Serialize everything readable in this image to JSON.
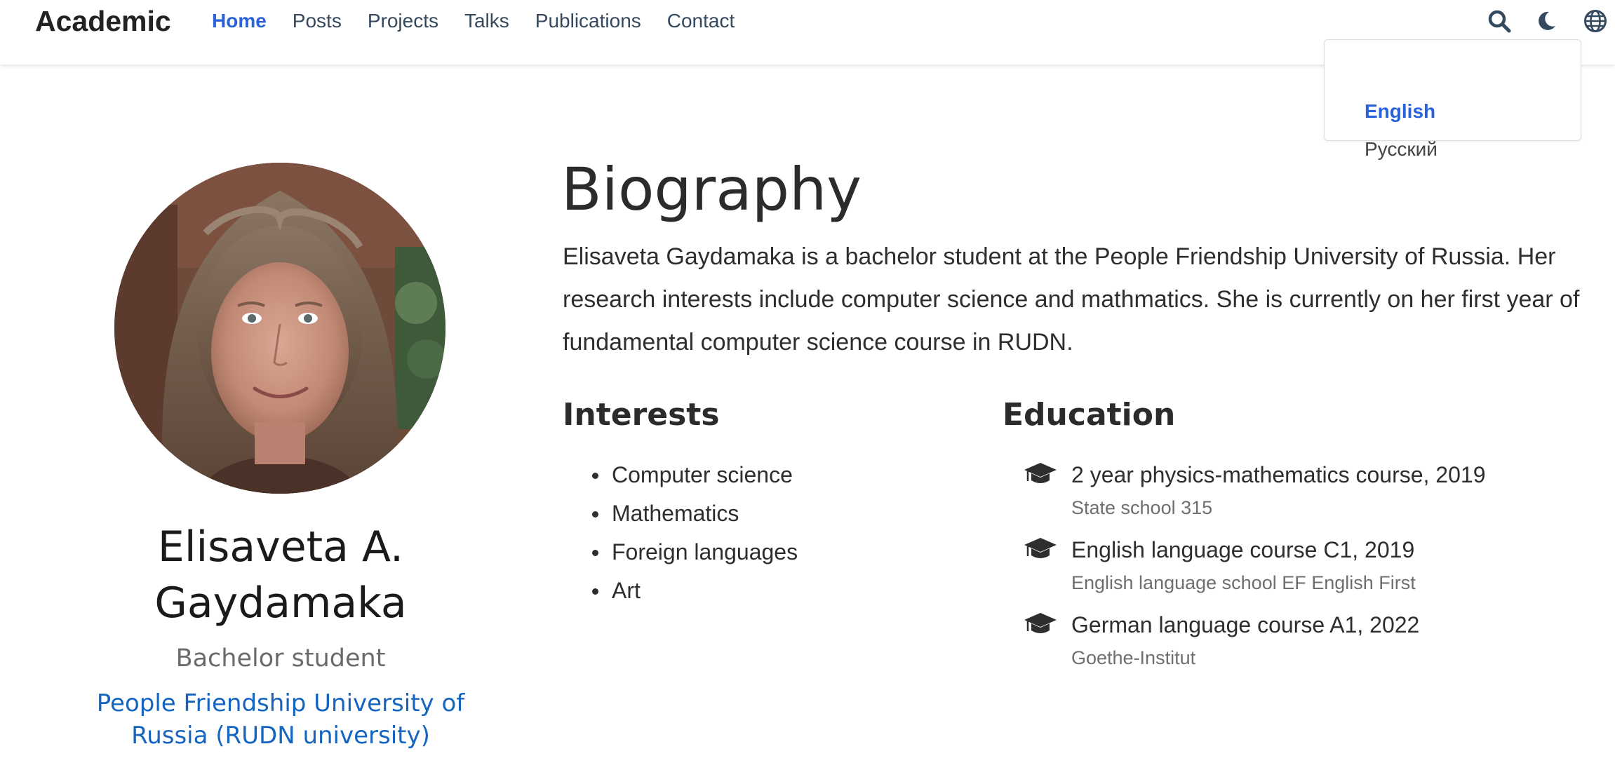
{
  "navbar": {
    "brand": "Academic",
    "links": [
      "Home",
      "Posts",
      "Projects",
      "Talks",
      "Publications",
      "Contact"
    ],
    "active_link": "Home",
    "icons": [
      "search-icon",
      "moon-icon",
      "globe-icon"
    ]
  },
  "language_menu": {
    "items": [
      "English",
      "Русский"
    ],
    "selected": "English"
  },
  "profile": {
    "name": "Elisaveta A. Gaydamaka",
    "role": "Bachelor student",
    "organization": "People Friendship University of Russia (RUDN university)"
  },
  "biography": {
    "title": "Biography",
    "text": "Elisaveta Gaydamaka is a bachelor student at the People Friendship University of Russia. Her research interests include computer science and mathmatics. She is currently on her first year of fundamental computer science course in RUDN."
  },
  "interests": {
    "title": "Interests",
    "items": [
      "Computer science",
      "Mathematics",
      "Foreign languages",
      "Art"
    ]
  },
  "education": {
    "title": "Education",
    "items": [
      {
        "course": "2 year physics-mathematics course, 2019",
        "institution": "State school 315"
      },
      {
        "course": "English language course C1, 2019",
        "institution": "English language school EF English First"
      },
      {
        "course": "German language course A1, 2022",
        "institution": "Goethe-Institut"
      }
    ]
  },
  "colors": {
    "accent": "#2962d9",
    "link": "#1565c0",
    "text": "#2b2b2b",
    "muted": "#6f6f6f"
  }
}
